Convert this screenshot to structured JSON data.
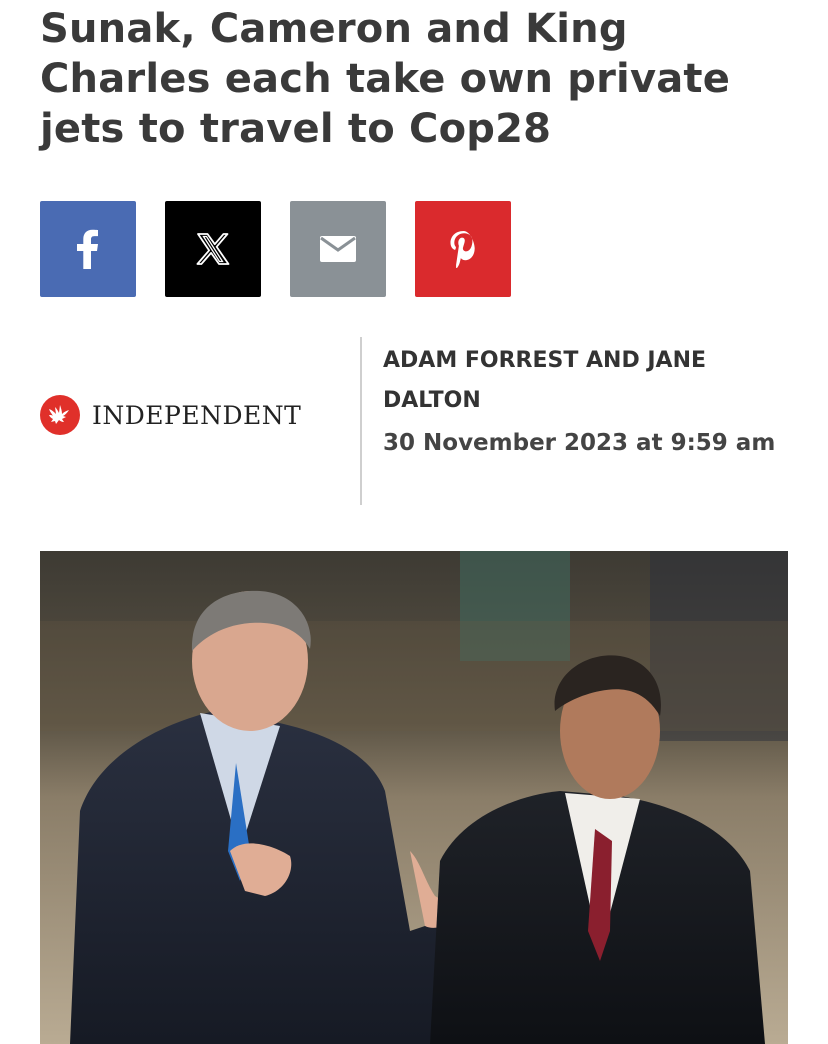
{
  "article": {
    "headline": "Sunak, Cameron and King Charles each take own private jets to travel to Cop28",
    "byline": "ADAM FORREST AND JANE DALTON",
    "date": "30 November 2023 at 9:59 am"
  },
  "publisher": {
    "name": "INDEPENDENT",
    "logo_icon": "eagle-icon",
    "logo_color": "#e0302a"
  },
  "share": {
    "buttons": [
      {
        "name": "facebook",
        "icon": "facebook-icon",
        "color": "#4a6bb3"
      },
      {
        "name": "x",
        "icon": "x-icon",
        "color": "#000000"
      },
      {
        "name": "email",
        "icon": "email-icon",
        "color": "#8a9196"
      },
      {
        "name": "pinterest",
        "icon": "pinterest-icon",
        "color": "#da2a2d"
      }
    ]
  },
  "hero_image": {
    "subject": "photo-two-men-walking"
  }
}
